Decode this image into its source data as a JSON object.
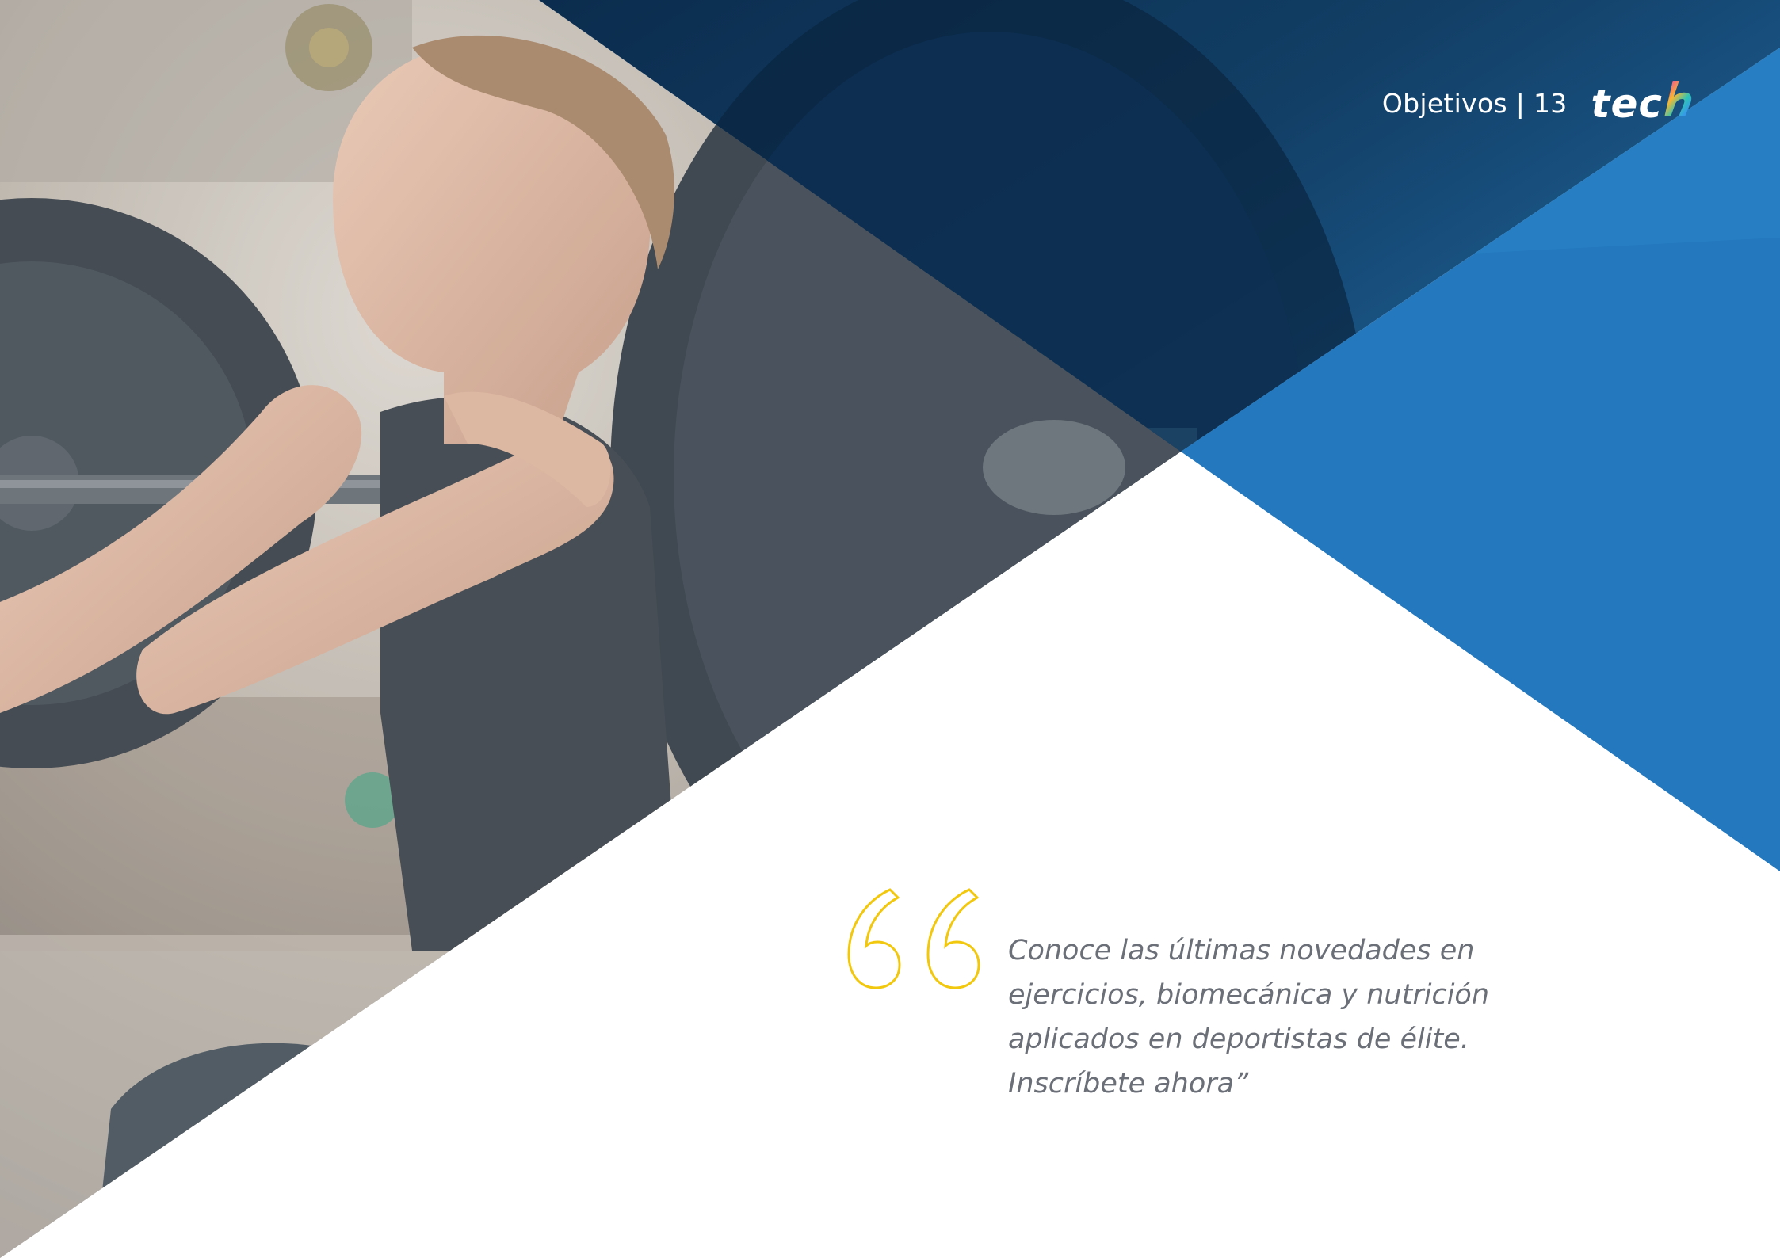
{
  "header": {
    "section_label": "Objetivos | 13",
    "logo_text": "tec",
    "logo_icon": "tech-h-rainbow-icon"
  },
  "hero_image": {
    "icon": "weightlifter-photo"
  },
  "quote": {
    "icon": "double-quote-icon",
    "lines": [
      "Conoce las últimas novedades en",
      "ejercicios, biomecánica y nutrición",
      "aplicados en deportistas de élite.",
      "Inscríbete ahora”"
    ]
  },
  "colors": {
    "primary_blue": "#2478bd",
    "dark_blue": "#0b2c4d",
    "accent_yellow": "#f2c80f",
    "text_gray": "#6b6f78"
  }
}
